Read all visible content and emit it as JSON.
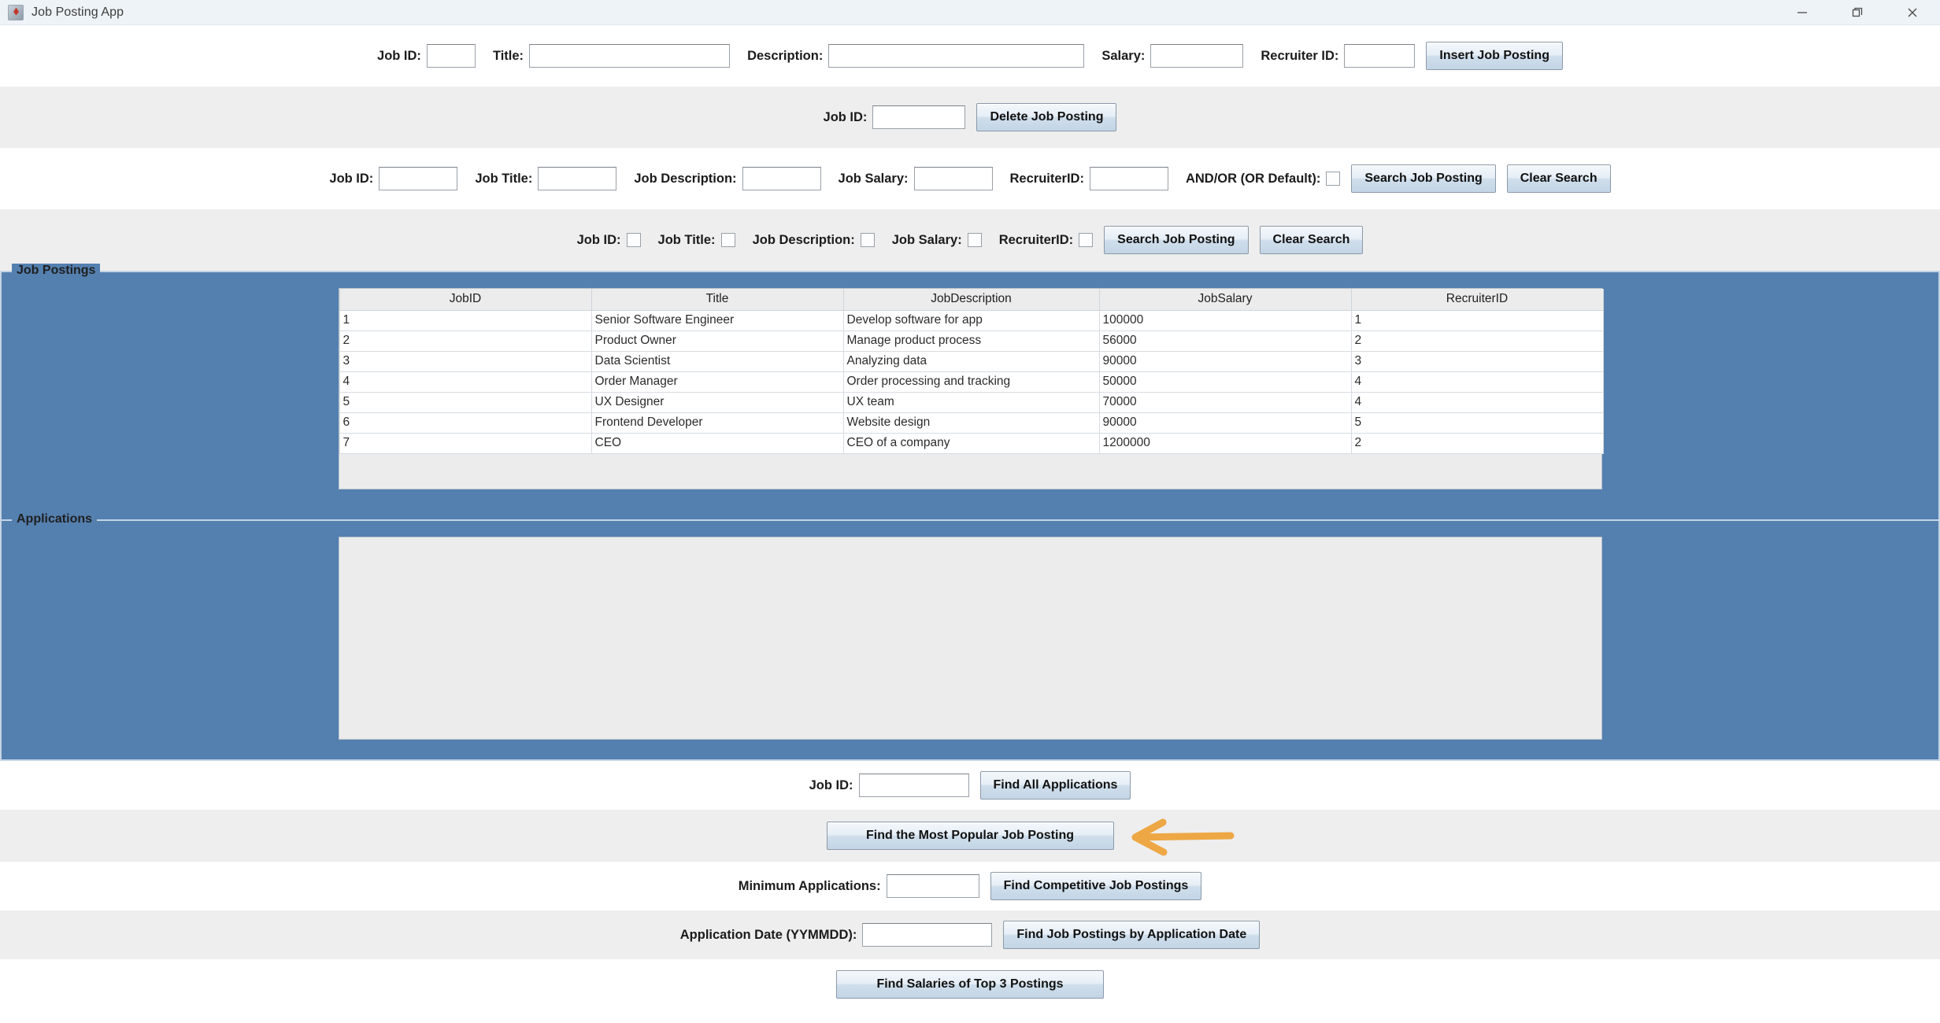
{
  "window": {
    "title": "Job Posting App",
    "icon": "app-icon",
    "controls": {
      "minimize": "minimize-icon",
      "restore": "restore-icon",
      "close": "close-icon"
    }
  },
  "insert_row": {
    "job_id_label": "Job ID:",
    "job_id_value": "",
    "title_label": "Title:",
    "title_value": "",
    "description_label": "Description:",
    "description_value": "",
    "salary_label": "Salary:",
    "salary_value": "",
    "recruiter_id_label": "Recruiter ID:",
    "recruiter_id_value": "",
    "insert_button": "Insert Job Posting"
  },
  "delete_row": {
    "job_id_label": "Job ID:",
    "job_id_value": "",
    "delete_button": "Delete Job Posting"
  },
  "search_text_row": {
    "job_id_label": "Job ID:",
    "job_id_value": "",
    "job_title_label": "Job Title:",
    "job_title_value": "",
    "job_description_label": "Job Description:",
    "job_description_value": "",
    "job_salary_label": "Job Salary:",
    "job_salary_value": "",
    "recruiter_id_label": "RecruiterID:",
    "recruiter_id_value": "",
    "and_or_label": "AND/OR (OR Default):",
    "and_or_checked": false,
    "search_button": "Search Job Posting",
    "clear_button": "Clear Search"
  },
  "search_checkbox_row": {
    "job_id_label": "Job ID:",
    "job_id_checked": false,
    "job_title_label": "Job Title:",
    "job_title_checked": false,
    "job_description_label": "Job Description:",
    "job_description_checked": false,
    "job_salary_label": "Job Salary:",
    "job_salary_checked": false,
    "recruiter_id_label": "RecruiterID:",
    "recruiter_id_checked": false,
    "search_button": "Search Job Posting",
    "clear_button": "Clear Search"
  },
  "job_postings_panel": {
    "title": "Job Postings",
    "columns": [
      "JobID",
      "Title",
      "JobDescription",
      "JobSalary",
      "RecruiterID"
    ],
    "rows": [
      [
        "1",
        "Senior Software Engineer",
        "Develop software for app",
        "100000",
        "1"
      ],
      [
        "2",
        "Product Owner",
        "Manage product process",
        "56000",
        "2"
      ],
      [
        "3",
        "Data Scientist",
        "Analyzing data",
        "90000",
        "3"
      ],
      [
        "4",
        "Order Manager",
        "Order processing and tracking",
        "50000",
        "4"
      ],
      [
        "5",
        "UX Designer",
        "UX team",
        "70000",
        "4"
      ],
      [
        "6",
        "Frontend Developer",
        "Website design",
        "90000",
        "5"
      ],
      [
        "7",
        "CEO",
        "CEO of a company",
        "1200000",
        "2"
      ]
    ]
  },
  "applications_panel": {
    "title": "Applications",
    "columns": [],
    "rows": []
  },
  "find_all_applications_row": {
    "job_id_label": "Job ID:",
    "job_id_value": "",
    "button": "Find All Applications"
  },
  "most_popular_row": {
    "button": "Find the Most Popular Job Posting",
    "annotation": "arrow-pointing-left"
  },
  "competitive_row": {
    "minimum_applications_label": "Minimum Applications:",
    "minimum_applications_value": "",
    "button": "Find Competitive Job Postings"
  },
  "application_date_row": {
    "label": "Application Date (YYMMDD):",
    "value": "",
    "button": "Find Job Postings by Application Date"
  },
  "top_salaries_row": {
    "button": "Find Salaries of Top 3 Postings"
  },
  "colors": {
    "panel_blue": "#5480b0",
    "band_gray": "#eeeeee",
    "titlebar": "#eef3f7",
    "annotation_orange": "#eda744",
    "button_face": "#dce8f2"
  }
}
